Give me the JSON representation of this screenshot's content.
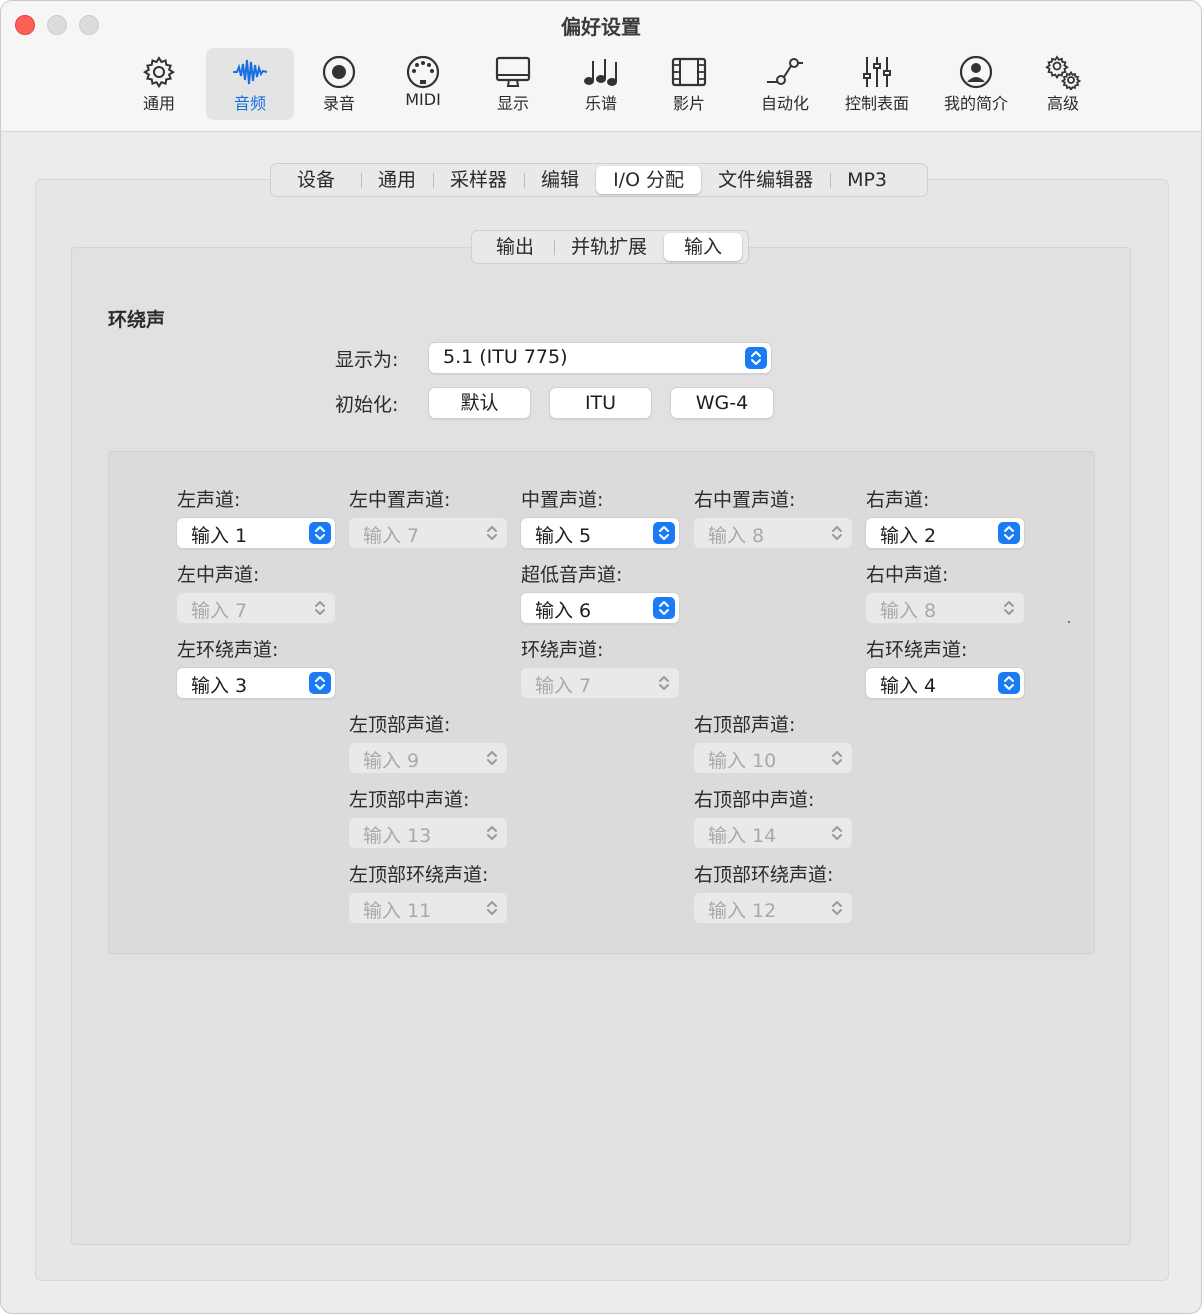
{
  "window": {
    "title": "偏好设置"
  },
  "toolbar": {
    "items": [
      {
        "label": "通用",
        "icon": "gear-icon"
      },
      {
        "label": "音频",
        "icon": "waveform-icon",
        "active": true
      },
      {
        "label": "录音",
        "icon": "record-icon"
      },
      {
        "label": "MIDI",
        "icon": "midi-connector-icon"
      },
      {
        "label": "显示",
        "icon": "monitor-icon"
      },
      {
        "label": "乐谱",
        "icon": "music-notes-icon"
      },
      {
        "label": "影片",
        "icon": "film-icon"
      },
      {
        "label": "自动化",
        "icon": "automation-curve-icon"
      },
      {
        "label": "控制表面",
        "icon": "faders-icon"
      },
      {
        "label": "我的简介",
        "icon": "person-icon"
      },
      {
        "label": "高级",
        "icon": "gears-icon"
      }
    ]
  },
  "tabs": {
    "items": [
      "设备",
      "通用",
      "采样器",
      "编辑",
      "I/O 分配",
      "文件编辑器",
      "MP3"
    ],
    "selected": "I/O 分配"
  },
  "subtabs": {
    "items": [
      "输出",
      "并轨扩展",
      "输入"
    ],
    "selected": "输入"
  },
  "surround": {
    "heading": "环绕声",
    "display_as_label": "显示为:",
    "display_as_value": "5.1 (ITU 775)",
    "init_label": "初始化:",
    "init_buttons": [
      "默认",
      "ITU",
      "WG-4"
    ]
  },
  "channels": {
    "left": {
      "label": "左声道:",
      "value": "输入 1",
      "enabled": true
    },
    "left_center_top": {
      "label": "左中置声道:",
      "value": "输入 7",
      "enabled": false
    },
    "center": {
      "label": "中置声道:",
      "value": "输入 5",
      "enabled": true
    },
    "right_center_top": {
      "label": "右中置声道:",
      "value": "输入 8",
      "enabled": false
    },
    "right": {
      "label": "右声道:",
      "value": "输入 2",
      "enabled": true
    },
    "left_center": {
      "label": "左中声道:",
      "value": "输入 7",
      "enabled": false
    },
    "lfe": {
      "label": "超低音声道:",
      "value": "输入 6",
      "enabled": true
    },
    "right_center": {
      "label": "右中声道:",
      "value": "输入 8",
      "enabled": false
    },
    "left_surround": {
      "label": "左环绕声道:",
      "value": "输入 3",
      "enabled": true
    },
    "surround": {
      "label": "环绕声道:",
      "value": "输入 7",
      "enabled": false
    },
    "right_surround": {
      "label": "右环绕声道:",
      "value": "输入 4",
      "enabled": true
    },
    "left_top": {
      "label": "左顶部声道:",
      "value": "输入 9",
      "enabled": false
    },
    "right_top": {
      "label": "右顶部声道:",
      "value": "输入 10",
      "enabled": false
    },
    "left_top_center": {
      "label": "左顶部中声道:",
      "value": "输入 13",
      "enabled": false
    },
    "right_top_center": {
      "label": "右顶部中声道:",
      "value": "输入 14",
      "enabled": false
    },
    "left_top_surround": {
      "label": "左顶部环绕声道:",
      "value": "输入 11",
      "enabled": false
    },
    "right_top_surround": {
      "label": "右顶部环绕声道:",
      "value": "输入 12",
      "enabled": false
    }
  },
  "colors": {
    "accent": "#1a7cf5",
    "close": "#fe5f57"
  }
}
